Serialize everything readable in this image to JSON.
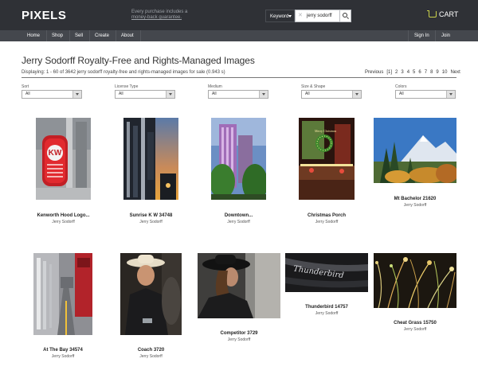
{
  "header": {
    "logo": "PIXELS",
    "promo_line1": "Every purchase includes a",
    "promo_line2": "money-back guarantee.",
    "search_type": "Keyword",
    "search_value": "jerry sodorff",
    "cart_label": "CART"
  },
  "nav": {
    "left": [
      "Home",
      "Shop",
      "Sell",
      "Create",
      "About"
    ],
    "right": [
      "Sign In",
      "Join"
    ]
  },
  "main": {
    "title": "Jerry Sodorff Royalty-Free and Rights-Managed Images",
    "displaying": "Displaying: 1 - 60 of 3642 jerry sodorff royalty-free and rights-managed images for sale (0.943 s)",
    "pager": [
      "Previous",
      "[1]",
      "2",
      "3",
      "4",
      "5",
      "6",
      "7",
      "8",
      "9",
      "10",
      "Next"
    ]
  },
  "filters": [
    {
      "label": "Sort",
      "value": "All"
    },
    {
      "label": "License Type",
      "value": "All"
    },
    {
      "label": "Medium",
      "value": "All"
    },
    {
      "label": "Size & Shape",
      "value": "All"
    },
    {
      "label": "Colors",
      "value": "All"
    }
  ],
  "items": [
    {
      "title": "Kenworth Hood Logo...",
      "author": "Jerry Sodorff"
    },
    {
      "title": "Sunrise K W 34748",
      "author": "Jerry Sodorff"
    },
    {
      "title": "Downtown...",
      "author": "Jerry Sodorff"
    },
    {
      "title": "Christmas Porch",
      "author": "Jerry Sodorff"
    },
    {
      "title": "Mt Bachelor 21620",
      "author": "Jerry Sodorff"
    },
    {
      "title": "At The Bay 34574",
      "author": "Jerry Sodorff"
    },
    {
      "title": "Coach 3720",
      "author": "Jerry Sodorff"
    },
    {
      "title": "Competitor 3729",
      "author": "Jerry Sodorff"
    },
    {
      "title": "Thunderbird 14757",
      "author": "Jerry Sodorff"
    },
    {
      "title": "Cheat Grass 15750",
      "author": "Jerry Sodorff"
    }
  ]
}
